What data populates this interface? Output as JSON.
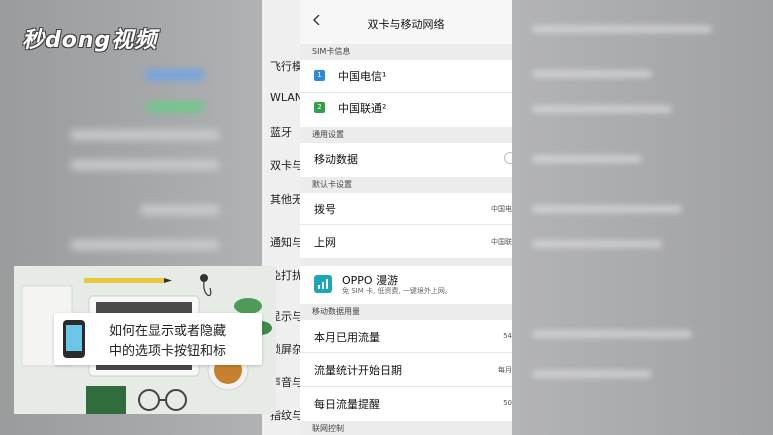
{
  "watermark": {
    "logo_text": "秒dong视频"
  },
  "left_settings": {
    "items": [
      "飞行模",
      "WLAN",
      "蓝牙",
      "双卡与",
      "其他无",
      "通知与",
      "免打扰",
      "显示与",
      "锁屏杂",
      "声音与",
      "指纹与"
    ]
  },
  "header": {
    "title": "双卡与移动网络"
  },
  "sections": {
    "sim_info": "SIM卡信息",
    "general": "通用设置",
    "default_card": "默认卡设置",
    "data_usage": "移动数据用量",
    "network_control": "联网控制"
  },
  "sims": [
    {
      "name": "中国电信¹",
      "icon_color": "#2a8cd8",
      "icon_glyph": "1"
    },
    {
      "name": "中国联通²",
      "icon_color": "#33a04a",
      "icon_glyph": "2"
    }
  ],
  "rows": {
    "mobile_data": "移动数据",
    "dial": "拨号",
    "dial_value": "中国电",
    "internet": "上网",
    "internet_value": "中国联",
    "oppo_title": "OPPO 漫游",
    "oppo_sub": "免 SIM 卡, 低资费, 一键境外上网。",
    "month_usage": "本月已用流量",
    "month_usage_value": "54",
    "stats_start": "流量统计开始日期",
    "stats_start_value": "每月",
    "daily_alert": "每日流量提醒",
    "daily_alert_value": "50"
  },
  "caption": {
    "line1": "如何在显示或者隐藏",
    "line2": "中的选项卡按钮和标"
  }
}
